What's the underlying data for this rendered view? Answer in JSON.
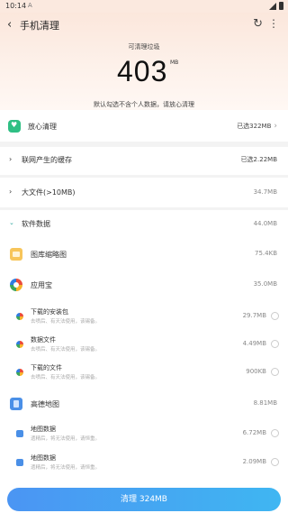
{
  "status_bar": {
    "time": "10:14",
    "alert_glyph": "A"
  },
  "header": {
    "title": "手机清理",
    "back_icon": "back-arrow-icon",
    "refresh_icon": "refresh-icon",
    "more_icon": "more-vertical-icon"
  },
  "summary": {
    "label": "可清理垃圾",
    "value": "403",
    "unit": "MB",
    "note": "默认勾选不含个人数据，请放心清理"
  },
  "categories": [
    {
      "label": "放心清理",
      "meta": "已选322MB"
    },
    {
      "label": "联网产生的缓存",
      "meta": "已选2.22MB"
    },
    {
      "label": "大文件(>10MB)",
      "meta": "34.7MB"
    },
    {
      "label": "软件数据",
      "meta": "44.0MB"
    }
  ],
  "apps": [
    {
      "name": "图库缩略图",
      "size": "75.4KB"
    },
    {
      "name": "应用宝",
      "size": "35.0MB",
      "items": [
        {
          "label": "下载的安装包",
          "desc": "去喷后、有天法使用，该锡备。",
          "size": "29.7MB"
        },
        {
          "label": "数据文件",
          "desc": "去喷后、有天法使用，该锡备。",
          "size": "4.49MB"
        },
        {
          "label": "下载的文件",
          "desc": "去喷后、有天法使用，该锡备。",
          "size": "900KB"
        }
      ]
    },
    {
      "name": "高德地图",
      "size": "8.81MB",
      "items": [
        {
          "label": "地图数据",
          "desc": "遗精后，将无法使用，请恒重。",
          "size": "6.72MB"
        },
        {
          "label": "地图数据",
          "desc": "遗精后，将无法使用，请恒重。",
          "size": "2.09MB"
        }
      ]
    }
  ],
  "action": {
    "label": "清理 324MB"
  },
  "colors": {
    "accent": "#3fa9f5",
    "safe_green": "#2fbf84",
    "hero_bg": "#fbe7dc"
  }
}
